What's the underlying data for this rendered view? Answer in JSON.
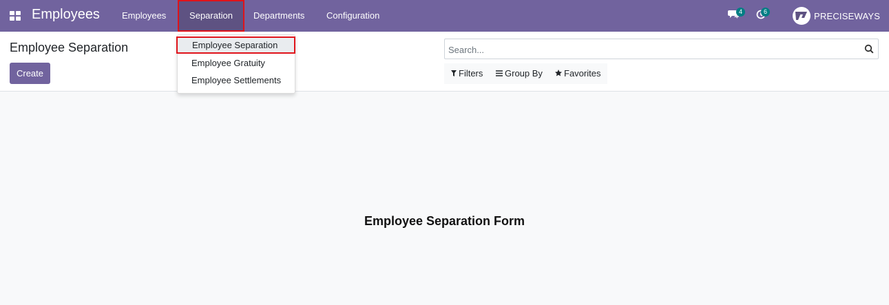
{
  "navbar": {
    "app_name": "Employees",
    "menu": [
      "Employees",
      "Separation",
      "Departments",
      "Configuration"
    ],
    "messages_count": "4",
    "activities_count": "6",
    "company": "PRECISEWAYS"
  },
  "dropdown": {
    "items": [
      "Employee Separation",
      "Employee Gratuity",
      "Employee Settlements"
    ]
  },
  "control_panel": {
    "title": "Employee Separation",
    "create_label": "Create",
    "search_placeholder": "Search...",
    "filters_label": "Filters",
    "group_by_label": "Group By",
    "favorites_label": "Favorites"
  },
  "main": {
    "label": "Employee Separation Form"
  },
  "colors": {
    "brand": "#71639e",
    "highlight_border": "#e0131a",
    "badge": "#017e84"
  }
}
